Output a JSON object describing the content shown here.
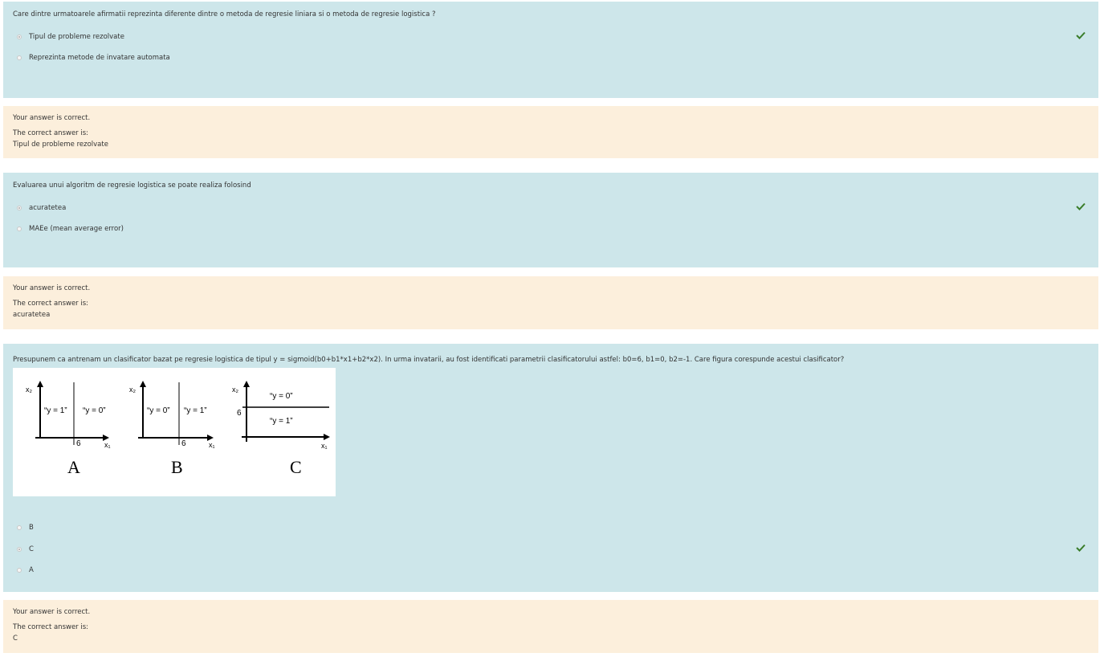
{
  "questions": [
    {
      "text": "Care dintre urmatoarele afirmatii reprezinta diferente dintre o metoda de regresie liniara si o metoda de regresie logistica ?",
      "options": [
        {
          "label": "Tipul de probleme rezolvate",
          "selected": true
        },
        {
          "label": "Reprezinta metode de invatare automata",
          "selected": false
        }
      ],
      "feedback": {
        "status": "Your answer is correct.",
        "correct_label": "The correct answer is:",
        "correct_answer": "Tipul de probleme rezolvate"
      }
    },
    {
      "text": "Evaluarea unui algoritm de regresie logistica se poate realiza folosind",
      "options": [
        {
          "label": "acuratetea",
          "selected": true
        },
        {
          "label": "MAEe (mean average error)",
          "selected": false
        }
      ],
      "feedback": {
        "status": "Your answer is correct.",
        "correct_label": "The correct answer is:",
        "correct_answer": "acuratetea"
      }
    },
    {
      "text": "Presupunem ca antrenam un clasificator bazat pe regresie logistica de tipul y = sigmoid(b0+b1*x1+b2*x2). In urma invatarii, au fost identificati parametrii clasificatorului astfel: b0=6, b1=0, b2=-1. Care figura corespunde acestui clasificator?",
      "figure": {
        "panels": [
          {
            "letter": "A",
            "left_label": "“y = 1”",
            "right_label": "“y = 0”",
            "tick": "6",
            "x_axis": "x₁",
            "y_axis": "x₂"
          },
          {
            "letter": "B",
            "left_label": "“y = 0”",
            "right_label": "“y = 1”",
            "tick": "6",
            "x_axis": "x₁",
            "y_axis": "x₂"
          },
          {
            "letter": "C",
            "top_label": "“y = 0”",
            "bottom_label": "“y = 1”",
            "tick": "6",
            "x_axis": "x₁",
            "y_axis": "x₂"
          }
        ]
      },
      "options": [
        {
          "label": "B",
          "selected": false
        },
        {
          "label": "C",
          "selected": true
        },
        {
          "label": "A",
          "selected": false
        }
      ],
      "feedback": {
        "status": "Your answer is correct.",
        "correct_label": "The correct answer is:",
        "correct_answer": "C"
      }
    }
  ],
  "colors": {
    "question_bg": "#cde6ea",
    "feedback_bg": "#fcefdc",
    "check": "#3a7d2a"
  },
  "icons": {
    "correct": "check-icon"
  }
}
